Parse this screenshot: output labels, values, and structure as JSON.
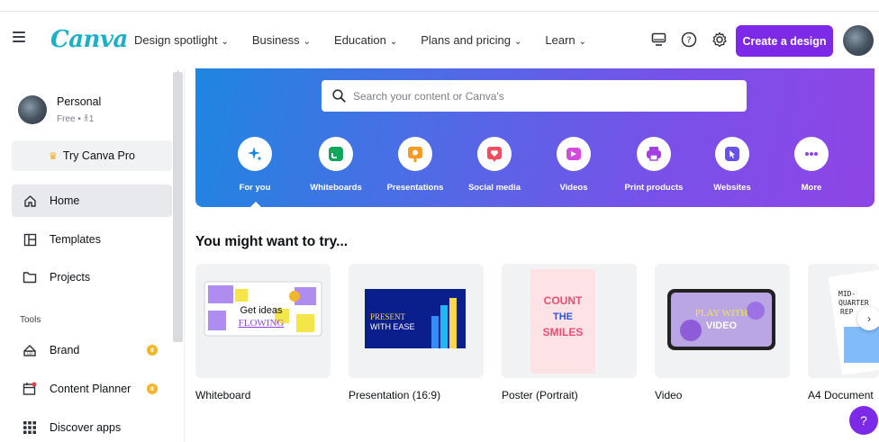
{
  "nav": {
    "logo": "Canva",
    "links": [
      {
        "label": "Design spotlight"
      },
      {
        "label": "Business"
      },
      {
        "label": "Education"
      },
      {
        "label": "Plans and pricing"
      },
      {
        "label": "Learn"
      }
    ],
    "icons": [
      "desktop-icon",
      "help-circle-icon",
      "gear-icon"
    ],
    "create_label": "Create a design",
    "chevron": "⌄"
  },
  "sidebar": {
    "profile_name": "Personal",
    "profile_sub": "Free • 𐀪1",
    "try_pro": "Try Canva Pro",
    "items": [
      {
        "label": "Home",
        "icon": "home-icon"
      },
      {
        "label": "Templates",
        "icon": "templates-icon"
      },
      {
        "label": "Projects",
        "icon": "folder-icon"
      }
    ],
    "tools_label": "Tools",
    "tools": [
      {
        "label": "Brand",
        "icon": "brand-icon"
      },
      {
        "label": "Content Planner",
        "icon": "calendar-icon"
      },
      {
        "label": "Discover apps",
        "icon": "apps-grid-icon"
      }
    ]
  },
  "search": {
    "placeholder": "Search your content or Canva's"
  },
  "categories": [
    {
      "label": "For you",
      "icon": "sparkle-icon",
      "color": "#1f86e0"
    },
    {
      "label": "Whiteboards",
      "icon": "whiteboard-icon",
      "color": "#13a45d"
    },
    {
      "label": "Presentations",
      "icon": "presentation-icon",
      "color": "#f59a23"
    },
    {
      "label": "Social media",
      "icon": "heart-icon",
      "color": "#ee4e5f"
    },
    {
      "label": "Videos",
      "icon": "video-icon",
      "color": "#d648e0"
    },
    {
      "label": "Print products",
      "icon": "printer-icon",
      "color": "#a63fe3"
    },
    {
      "label": "Websites",
      "icon": "cursor-icon",
      "color": "#6652e8"
    },
    {
      "label": "More",
      "icon": "more-icon",
      "color": "#8e45e6"
    }
  ],
  "suggestions": {
    "title": "You might want to try...",
    "cards": [
      {
        "label": "Whiteboard",
        "art_text": "Get ideas",
        "art_text2": "FLOWING"
      },
      {
        "label": "Presentation (16:9)",
        "art_text": "PRESENT",
        "art_text2": "WITH EASE"
      },
      {
        "label": "Poster (Portrait)",
        "art_text": "COUNT",
        "art_text2": "THE",
        "art_text3": "SMILES"
      },
      {
        "label": "Video",
        "art_text": "PLAY WITH",
        "art_text2": "VIDEO"
      },
      {
        "label": "A4 Document",
        "art_text": "MID-",
        "art_text2": "QUARTER",
        "art_text3": "REP"
      }
    ]
  },
  "help_label": "?",
  "next_label": "›",
  "colors": {
    "accent": "#7d2ae8",
    "logo": "#1ab0c6",
    "crown": "#f3a712"
  }
}
